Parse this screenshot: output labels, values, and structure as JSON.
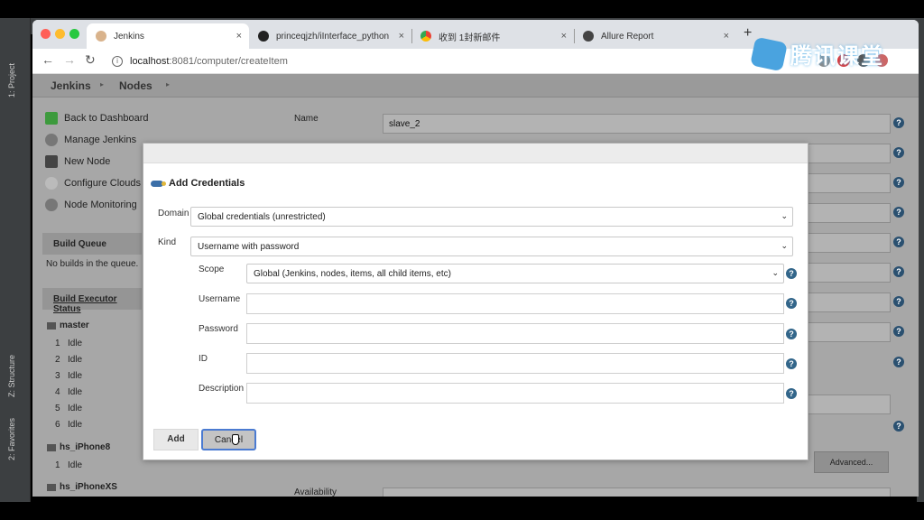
{
  "ide": {
    "tab_project": "1: Project",
    "tab_structure": "Z: Structure",
    "tab_favorites": "2: Favorites"
  },
  "browser": {
    "tabs": [
      {
        "label": "Jenkins",
        "active": true
      },
      {
        "label": "princeqjzh/iInterface_python",
        "active": false
      },
      {
        "label": "收到 1封新邮件",
        "active": false
      },
      {
        "label": "Allure Report",
        "active": false
      }
    ],
    "close_glyph": "×",
    "new_tab_glyph": "+",
    "url_host": "localhost",
    "url_path": ":8081/computer/createItem",
    "watermark": "腾讯课堂"
  },
  "jenkins": {
    "breadcrumbs": [
      "Jenkins",
      "Nodes"
    ],
    "crumb_sep": "▸",
    "sidebar_links": [
      "Back to Dashboard",
      "Manage Jenkins",
      "New Node",
      "Configure Clouds",
      "Node Monitoring"
    ],
    "build_queue": {
      "title": "Build Queue",
      "empty": "No builds in the queue."
    },
    "executor_status": {
      "title": "Build Executor Status",
      "nodes": [
        {
          "name": "master",
          "executors": [
            {
              "num": "1",
              "state": "Idle"
            },
            {
              "num": "2",
              "state": "Idle"
            },
            {
              "num": "3",
              "state": "Idle"
            },
            {
              "num": "4",
              "state": "Idle"
            },
            {
              "num": "5",
              "state": "Idle"
            },
            {
              "num": "6",
              "state": "Idle"
            }
          ]
        },
        {
          "name": "hs_iPhone8",
          "executors": [
            {
              "num": "1",
              "state": "Idle"
            }
          ]
        },
        {
          "name": "hs_iPhoneXS",
          "executors": []
        }
      ]
    },
    "form": {
      "name_label": "Name",
      "name_value": "slave_2",
      "availability_label": "Availability",
      "advanced_button": "Advanced..."
    }
  },
  "dialog": {
    "title": "Add Credentials",
    "domain_label": "Domain",
    "domain_value": "Global credentials (unrestricted)",
    "kind_label": "Kind",
    "kind_value": "Username with password",
    "scope_label": "Scope",
    "scope_value": "Global (Jenkins, nodes, items, all child items, etc)",
    "username_label": "Username",
    "password_label": "Password",
    "id_label": "ID",
    "description_label": "Description",
    "add_button": "Add",
    "cancel_button": "Cancel",
    "help_glyph": "?",
    "caret_glyph": "⌄"
  },
  "colors": {
    "accent_blue": "#33668a",
    "dialog_focus": "#4b7bd1"
  }
}
